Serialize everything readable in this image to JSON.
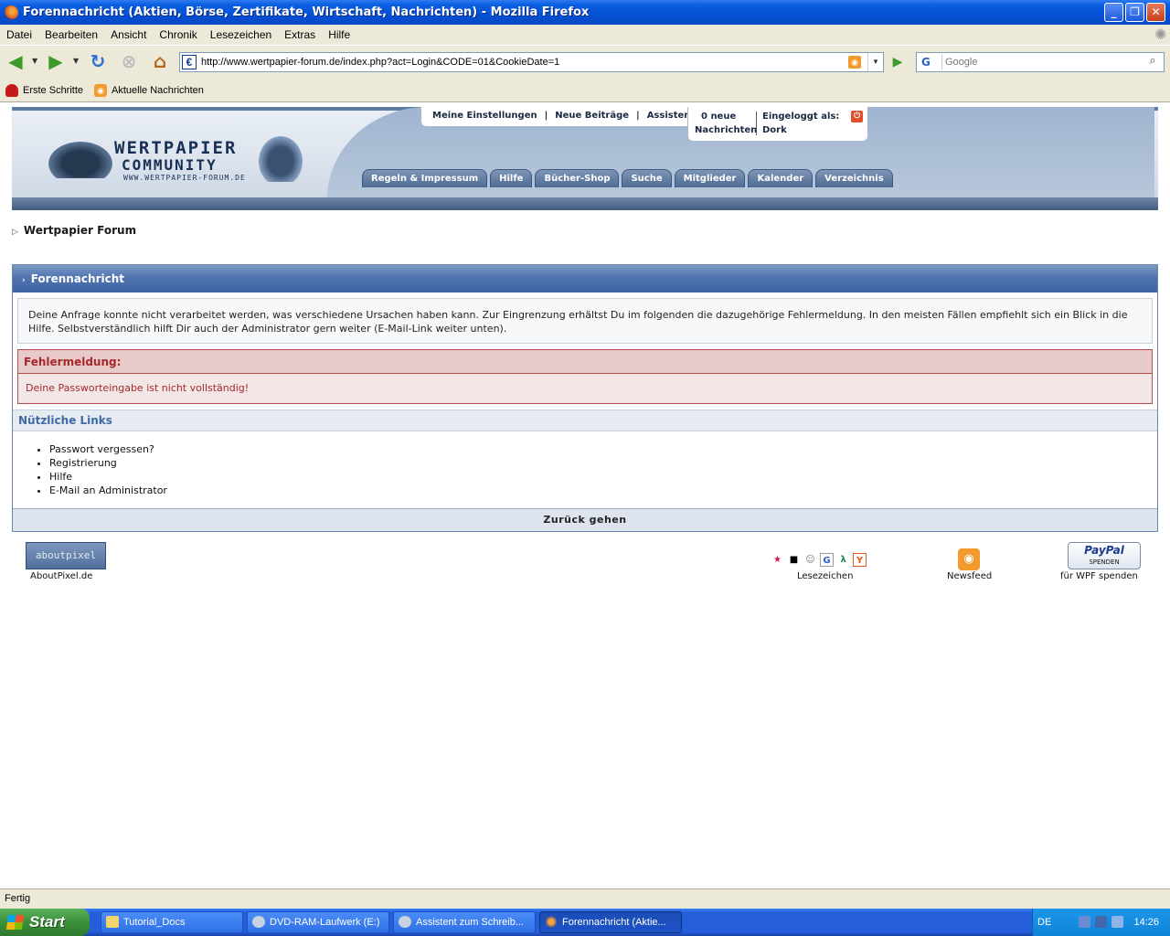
{
  "window": {
    "title": "Forennachricht (Aktien, Börse, Zertifikate, Wirtschaft, Nachrichten) - Mozilla Firefox",
    "min": "_",
    "max": "❐",
    "close": "✕"
  },
  "menu": [
    "Datei",
    "Bearbeiten",
    "Ansicht",
    "Chronik",
    "Lesezeichen",
    "Extras",
    "Hilfe"
  ],
  "nav": {
    "url": "http://www.wertpapier-forum.de/index.php?act=Login&CODE=01&CookieDate=1",
    "site_icon": "€",
    "search_engine": "G",
    "search_placeholder": "Google"
  },
  "bookmarks": [
    {
      "label": "Erste Schritte",
      "icon": "firefox-red-icon"
    },
    {
      "label": "Aktuelle Nachrichten",
      "icon": "rss-feed-icon"
    }
  ],
  "site": {
    "logo": {
      "line1": "WERTPAPIER",
      "line2": "COMMUNITY",
      "line3": "WWW.WERTPAPIER-FORUM.DE"
    },
    "toplinks": [
      "Meine Einstellungen",
      "|",
      "Neue Beiträge",
      "|",
      "Assistent"
    ],
    "messages": {
      "count": "0 neue",
      "label": "Nachrichten",
      "logged_in": "Eingeloggt als:",
      "user": "Dork"
    },
    "tabs": [
      "Regeln & Impressum",
      "Hilfe",
      "Bücher-Shop",
      "Suche",
      "Mitglieder",
      "Kalender",
      "Verzeichnis"
    ],
    "breadcrumb": "Wertpapier Forum"
  },
  "message": {
    "header": "Forennachricht",
    "info": "Deine Anfrage konnte nicht verarbeitet werden, was verschiedene Ursachen haben kann. Zur Eingrenzung erhältst Du im folgenden die dazugehörige Fehlermeldung. In den meisten Fällen empfiehlt sich ein Blick in die Hilfe. Selbstverständlich hilft Dir auch der Administrator gern weiter (E-Mail-Link weiter unten).",
    "error_title": "Fehlermeldung:",
    "error_text": "Deine Passworteingabe ist nicht vollständig!",
    "links_title": "Nützliche Links",
    "links": [
      "Passwort vergessen?",
      "Registrierung",
      "Hilfe",
      "E-Mail an Administrator"
    ],
    "back": "Zurück gehen"
  },
  "footer": {
    "aboutpixel_badge": "aboutpixel",
    "aboutpixel": "AboutPixel.de",
    "lesezeichen": "Lesezeichen",
    "newsfeed": "Newsfeed",
    "paypal_logo": "PayPal",
    "paypal_sub": "SPENDEN",
    "paypal": "für WPF spenden"
  },
  "status": "Fertig",
  "taskbar": {
    "start": "Start",
    "items": [
      "Tutorial_Docs",
      "DVD-RAM-Laufwerk (E:)",
      "Assistent zum Schreib...",
      "Forennachricht (Aktie..."
    ],
    "lang": "DE",
    "clock": "14:26"
  }
}
